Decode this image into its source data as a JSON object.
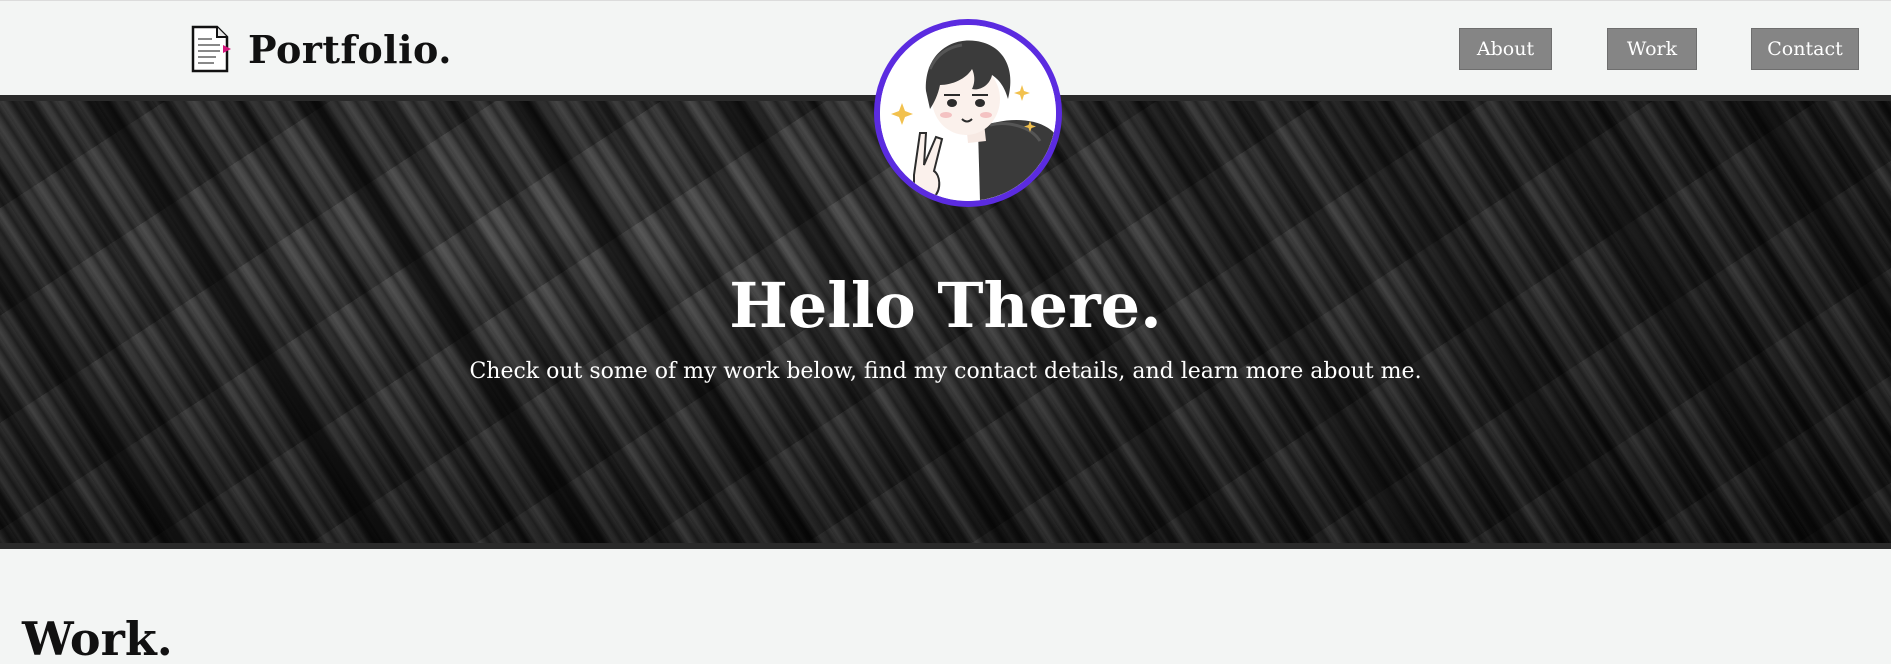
{
  "header": {
    "brand_title": "Portfolio.",
    "brand_icon": "document-icon",
    "nav": [
      {
        "label": "About"
      },
      {
        "label": "Work"
      },
      {
        "label": "Contact"
      }
    ]
  },
  "hero": {
    "title": "Hello There.",
    "subtitle": "Check out some of my work below, find my contact details, and learn more about me.",
    "avatar_icon": "profile-avatar-illustration"
  },
  "work": {
    "title": "Work."
  },
  "colors": {
    "page_bg": "#f3f5f4",
    "nav_button": "#858585",
    "avatar_ring": "#5b2be0",
    "brand_accent": "#d4147a"
  }
}
